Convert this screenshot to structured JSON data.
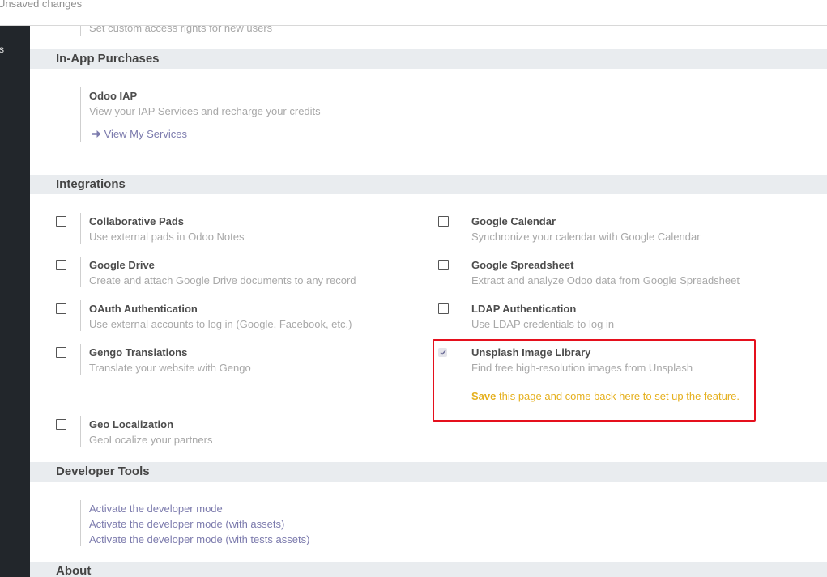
{
  "topbar": {
    "status": "Unsaved changes"
  },
  "sidebar": {
    "fragment": "s"
  },
  "top_fragment": "Set custom access rights for new users",
  "iap": {
    "section_title": "In-App Purchases",
    "title": "Odoo IAP",
    "description": "View your IAP Services and recharge your credits",
    "link_label": "View My Services"
  },
  "integrations": {
    "section_title": "Integrations",
    "collaborative_pads": {
      "title": "Collaborative Pads",
      "description": "Use external pads in Odoo Notes"
    },
    "google_calendar": {
      "title": "Google Calendar",
      "description": "Synchronize your calendar with Google Calendar"
    },
    "google_drive": {
      "title": "Google Drive",
      "description": "Create and attach Google Drive documents to any record"
    },
    "google_spreadsheet": {
      "title": "Google Spreadsheet",
      "description": "Extract and analyze Odoo data from Google Spreadsheet"
    },
    "oauth": {
      "title": "OAuth Authentication",
      "description": "Use external accounts to log in (Google, Facebook, etc.)"
    },
    "ldap": {
      "title": "LDAP Authentication",
      "description": "Use LDAP credentials to log in"
    },
    "gengo": {
      "title": "Gengo Translations",
      "description": "Translate your website with Gengo"
    },
    "unsplash": {
      "title": "Unsplash Image Library",
      "description": "Find free high-resolution images from Unsplash",
      "save_word": "Save",
      "save_rest": " this page and come back here to set up the feature."
    },
    "geo": {
      "title": "Geo Localization",
      "description": "GeoLocalize your partners"
    }
  },
  "developer": {
    "section_title": "Developer Tools",
    "links": [
      "Activate the developer mode",
      "Activate the developer mode (with assets)",
      "Activate the developer mode (with tests assets)"
    ]
  },
  "about": {
    "section_title": "About"
  },
  "colors": {
    "accent": "#7c7bad",
    "warning": "#e5b01e",
    "highlight": "#e5101d",
    "sidebar": "#22262b"
  }
}
